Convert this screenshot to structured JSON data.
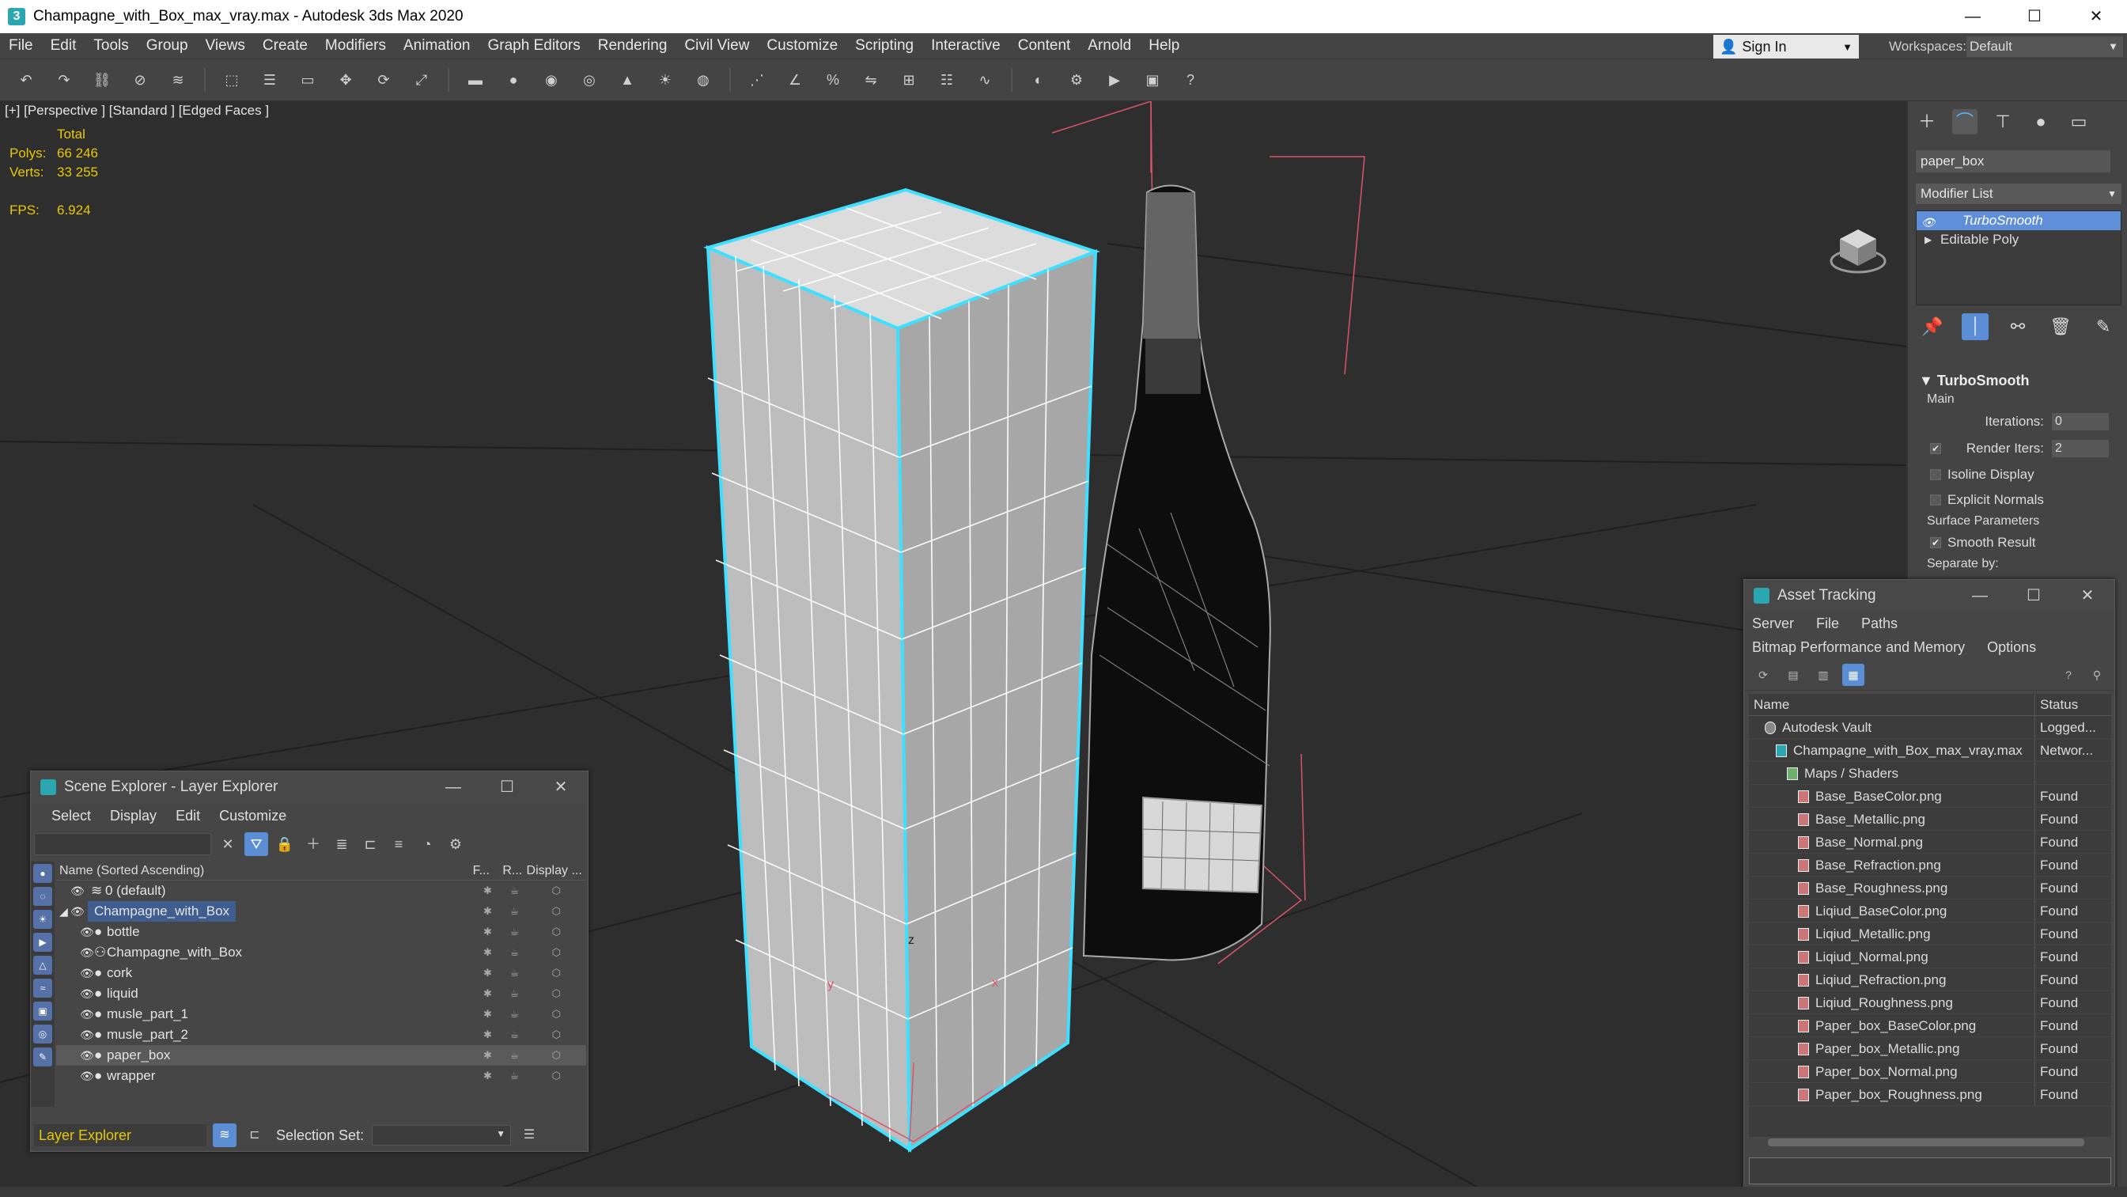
{
  "window": {
    "title": "Champagne_with_Box_max_vray.max - Autodesk 3ds Max 2020",
    "minimize": "—",
    "maximize": "☐",
    "close": "✕"
  },
  "menu": [
    "File",
    "Edit",
    "Tools",
    "Group",
    "Views",
    "Create",
    "Modifiers",
    "Animation",
    "Graph Editors",
    "Rendering",
    "Civil View",
    "Customize",
    "Scripting",
    "Interactive",
    "Content",
    "Arnold",
    "Help"
  ],
  "signin": {
    "label": "Sign In"
  },
  "workspaces": {
    "label": "Workspaces:",
    "value": "Default"
  },
  "viewport": {
    "label": "[+] [Perspective ] [Standard ] [Edged Faces ]",
    "stats_total": "Total",
    "polys_label": "Polys:",
    "polys_value": "66 246",
    "verts_label": "Verts:",
    "verts_value": "33 255",
    "fps_label": "FPS:",
    "fps_value": "6.924",
    "axis_z": "z",
    "axis_x": "x",
    "axis_y": "y"
  },
  "command_panel": {
    "object_name": "paper_box",
    "modifier_list": "Modifier List",
    "stack": [
      "TurboSmooth",
      "Editable Poly"
    ],
    "rollout_title": "TurboSmooth",
    "main_label": "Main",
    "iterations_label": "Iterations:",
    "iterations_value": "0",
    "render_iters_label": "Render Iters:",
    "render_iters_value": "2",
    "isoline_label": "Isoline Display",
    "explicit_normals_label": "Explicit Normals",
    "surface_params_label": "Surface Parameters",
    "smooth_result_label": "Smooth Result",
    "separate_by_label": "Separate by:"
  },
  "scene_explorer": {
    "title": "Scene Explorer - Layer Explorer",
    "menu": [
      "Select",
      "Display",
      "Edit",
      "Customize"
    ],
    "columns": {
      "name": "Name (Sorted Ascending)",
      "freeze": "F...",
      "render": "R...",
      "display": "Display ..."
    },
    "rows": [
      {
        "name": "0 (default)"
      },
      {
        "name": "Champagne_with_Box"
      },
      {
        "name": "bottle"
      },
      {
        "name": "Champagne_with_Box"
      },
      {
        "name": "cork"
      },
      {
        "name": "liquid"
      },
      {
        "name": "musle_part_1"
      },
      {
        "name": "musle_part_2"
      },
      {
        "name": "paper_box"
      },
      {
        "name": "wrapper"
      }
    ],
    "footer_layer": "Layer Explorer",
    "selection_set_label": "Selection Set:"
  },
  "asset_tracking": {
    "title": "Asset Tracking",
    "menu": [
      "Server",
      "File",
      "Paths"
    ],
    "menu2": [
      "Bitmap Performance and Memory",
      "Options"
    ],
    "columns": {
      "name": "Name",
      "status": "Status"
    },
    "rows": [
      {
        "name": "Autodesk Vault",
        "status": "Logged..."
      },
      {
        "name": "Champagne_with_Box_max_vray.max",
        "status": "Networ..."
      },
      {
        "name": "Maps / Shaders",
        "status": ""
      },
      {
        "name": "Base_BaseColor.png",
        "status": "Found"
      },
      {
        "name": "Base_Metallic.png",
        "status": "Found"
      },
      {
        "name": "Base_Normal.png",
        "status": "Found"
      },
      {
        "name": "Base_Refraction.png",
        "status": "Found"
      },
      {
        "name": "Base_Roughness.png",
        "status": "Found"
      },
      {
        "name": "Liqiud_BaseColor.png",
        "status": "Found"
      },
      {
        "name": "Liqiud_Metallic.png",
        "status": "Found"
      },
      {
        "name": "Liqiud_Normal.png",
        "status": "Found"
      },
      {
        "name": "Liqiud_Refraction.png",
        "status": "Found"
      },
      {
        "name": "Liqiud_Roughness.png",
        "status": "Found"
      },
      {
        "name": "Paper_box_BaseColor.png",
        "status": "Found"
      },
      {
        "name": "Paper_box_Metallic.png",
        "status": "Found"
      },
      {
        "name": "Paper_box_Normal.png",
        "status": "Found"
      },
      {
        "name": "Paper_box_Roughness.png",
        "status": "Found"
      }
    ]
  },
  "colors": {
    "selection_blue": "#5c8ed6",
    "stats_yellow": "#e8c900",
    "box_highlight": "#3fe0ff",
    "gizmo_red": "#d9546a"
  }
}
